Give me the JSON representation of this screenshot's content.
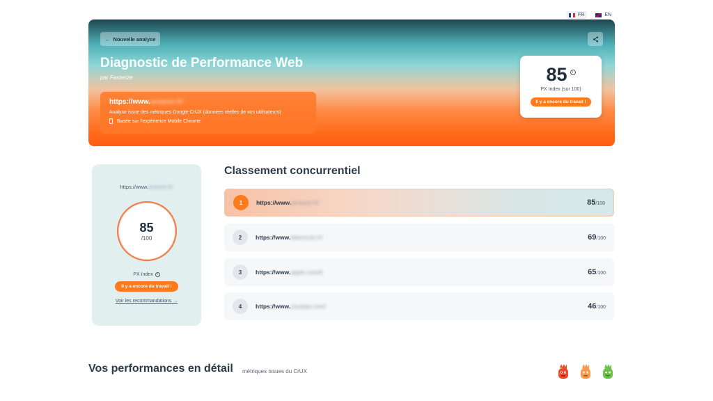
{
  "languages": [
    {
      "code": "FR",
      "active": true
    },
    {
      "code": "EN",
      "active": false
    }
  ],
  "hero": {
    "back_label": "Nouvelle analyse",
    "title": "Diagnostic de Performance Web",
    "subtitle": "par Fasterize",
    "url_prefix": "https://www.",
    "url_blurred": "amazon.fr/",
    "description": "Analyse issue des métriques Google CrUX (données réelles de vos utilisateurs)",
    "device": "Basée sur l'expérience Mobile Chrome"
  },
  "score_card": {
    "score": "85",
    "label": "PX Index (sur 100)",
    "badge": "Il y a encore du travail !"
  },
  "left_panel": {
    "url_prefix": "https://www.",
    "url_blurred": "amazon.fr/",
    "score": "85",
    "denominator": "/100",
    "label": "PX Index",
    "badge": "Il y a encore du travail !",
    "recommendations": "Voir les recommandations →"
  },
  "ranking": {
    "title": "Classement concurrentiel",
    "out_of": "/100",
    "rows": [
      {
        "rank": "1",
        "url_prefix": "https://www.",
        "url_blurred": "amazon.fr/",
        "score": "85"
      },
      {
        "rank": "2",
        "url_prefix": "https://www.",
        "url_blurred": "leboncoin.fr/",
        "score": "69"
      },
      {
        "rank": "3",
        "url_prefix": "https://www.",
        "url_blurred": "apple.com/fr",
        "score": "65"
      },
      {
        "rank": "4",
        "url_prefix": "https://www.",
        "url_blurred": "youtube.com/",
        "score": "46"
      }
    ]
  },
  "performance": {
    "title": "Vos performances en détail",
    "subtitle": "métriques issues du CrUX"
  },
  "colors": {
    "accent": "#ff7a1a",
    "mascot_red": "#f04a2a",
    "mascot_orange": "#f79a4a",
    "mascot_green": "#6cc24a"
  }
}
